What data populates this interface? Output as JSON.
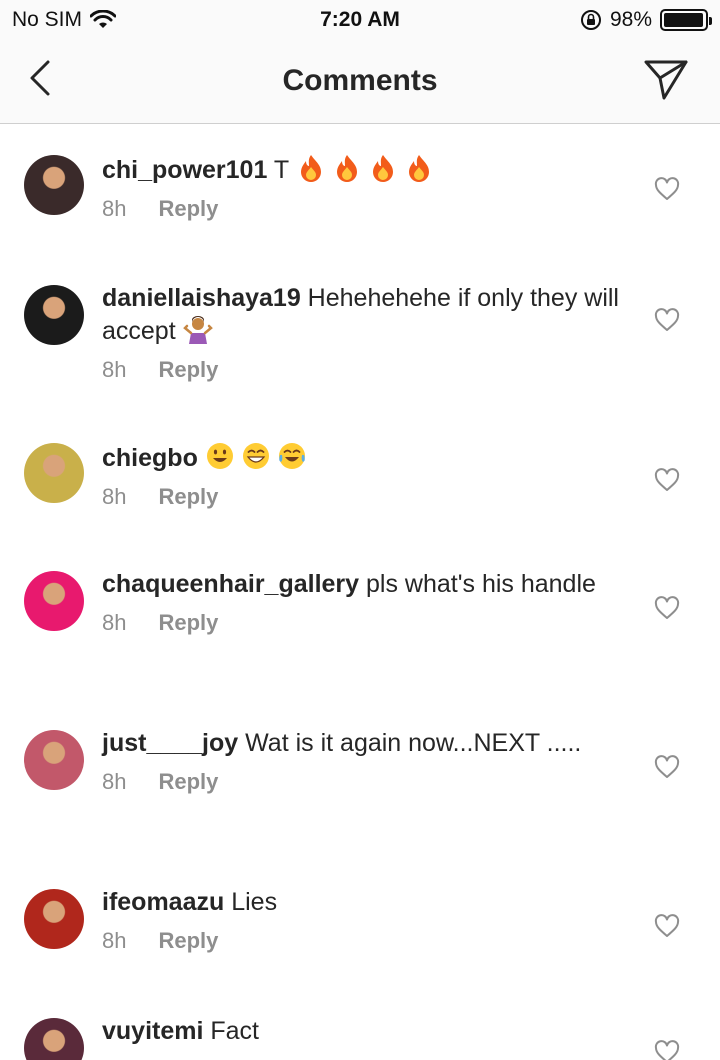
{
  "status_bar": {
    "carrier": "No SIM",
    "time": "7:20 AM",
    "battery": "98%",
    "battery_level": 0.98
  },
  "nav": {
    "title": "Comments"
  },
  "icons": {
    "back": "chevron-left-icon",
    "send": "paper-plane-icon",
    "heart": "heart-outline-icon",
    "wifi": "wifi-icon",
    "lock": "rotation-lock-icon"
  },
  "colors": {
    "text": "#262626",
    "secondary": "#8e8e8e",
    "fire": "#f25c1a",
    "smiley": "#ffcc33"
  },
  "comments": [
    {
      "username": "chi_power101",
      "text": "T",
      "emojis": [
        "fire",
        "fire",
        "fire",
        "fire"
      ],
      "time": "8h",
      "reply": "Reply",
      "avatar_color": "#3a2a2a"
    },
    {
      "username": "daniellaishaya19",
      "text": "Hehehehehe if only they will accept",
      "emojis": [
        "person-shrugging"
      ],
      "time": "8h",
      "reply": "Reply",
      "avatar_color": "#1b1b1b"
    },
    {
      "username": "chiegbo",
      "text": "",
      "emojis": [
        "grinning-face",
        "beaming-face",
        "tears-of-joy"
      ],
      "time": "8h",
      "reply": "Reply",
      "avatar_color": "#c9b04a"
    },
    {
      "username": "chaqueenhair_gallery",
      "text": "pls what's his handle",
      "emojis": [],
      "time": "8h",
      "reply": "Reply",
      "avatar_color": "#e8196e"
    },
    {
      "username": "just____joy",
      "text": "Wat is it again now...NEXT .....",
      "emojis": [],
      "time": "8h",
      "reply": "Reply",
      "avatar_color": "#c2586a"
    },
    {
      "username": "ifeomaazu",
      "text": "Lies",
      "emojis": [],
      "time": "8h",
      "reply": "Reply",
      "avatar_color": "#b0271c"
    },
    {
      "username": "vuyitemi",
      "text": "Fact",
      "emojis": [],
      "time": "",
      "reply": "",
      "avatar_color": "#5a2a3a"
    }
  ]
}
